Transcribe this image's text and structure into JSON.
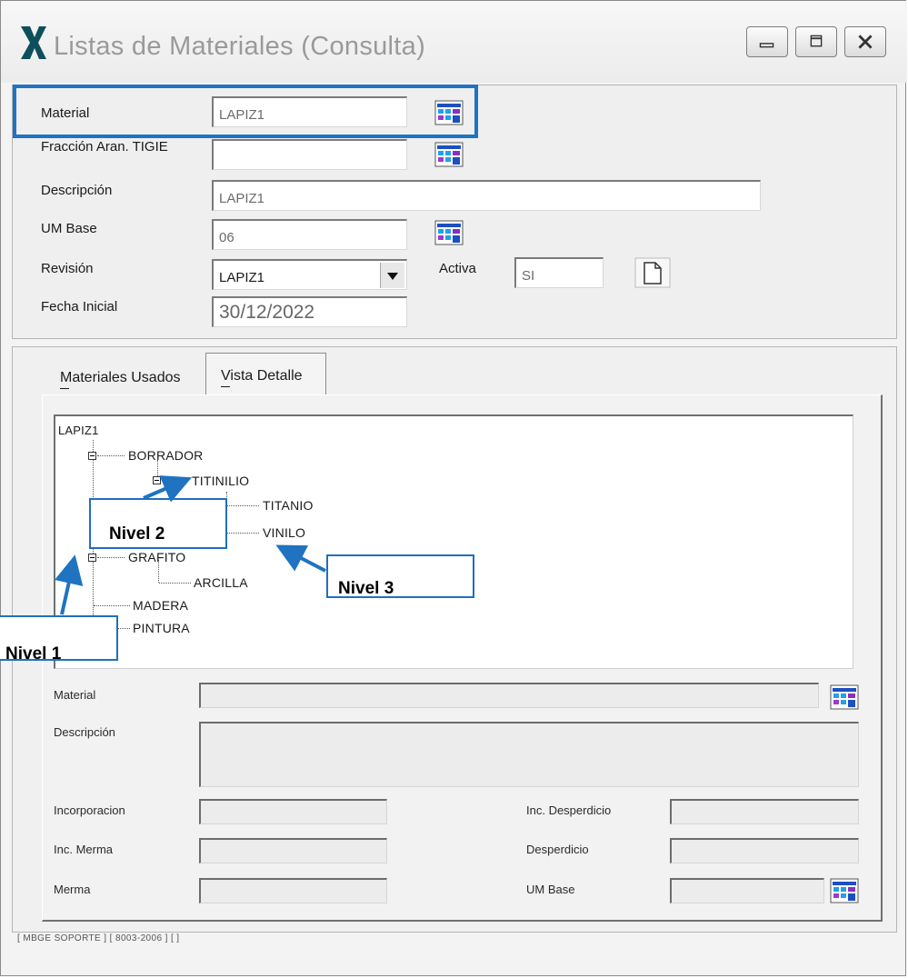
{
  "window": {
    "title": "Listas de Materiales (Consulta)",
    "buttons": [
      "minimize-icon",
      "restore-icon",
      "close-icon"
    ]
  },
  "header": {
    "material_label": "Material",
    "material_value": "LAPIZ1",
    "fraccion_label": "Fracción Aran. TIGIE",
    "fraccion_value": "",
    "descripcion_label": "Descripción",
    "descripcion_value": "LAPIZ1",
    "um_base_label": "UM Base",
    "um_base_value": "06",
    "revision_label": "Revisión",
    "revision_value": "LAPIZ1",
    "activa_label": "Activa",
    "activa_value": "SI",
    "fecha_label": "Fecha Inicial",
    "fecha_value": "30/12/2022"
  },
  "tabs": [
    {
      "label": "Materiales Usados",
      "active": false
    },
    {
      "label": "Vista Detalle",
      "active": true
    }
  ],
  "tree": {
    "root": "LAPIZ1",
    "nodes": {
      "borrador": "BORRADOR",
      "titinilio": "TITINILIO",
      "titanio": "TITANIO",
      "vinilo": "VINILO",
      "grafito": "GRAFITO",
      "arcilla": "ARCILLA",
      "madera": "MADERA",
      "pintura": "PINTURA"
    }
  },
  "detail": {
    "material_label": "Material",
    "descripcion_label": "Descripción",
    "incorporacion_label": "Incorporacion",
    "inc_merma_label": "Inc. Merma",
    "merma_label": "Merma",
    "inc_desperdicio_label": "Inc. Desperdicio",
    "desperdicio_label": "Desperdicio",
    "um_base_label": "UM Base"
  },
  "status_bar": "[ MBGE SOPORTE ] [ 8003-2006 ] [ ]",
  "annotations": {
    "nivel1": "Nivel 1",
    "nivel2": "Nivel 2",
    "nivel3": "Nivel 3",
    "accent_color": "#1f73c1"
  }
}
